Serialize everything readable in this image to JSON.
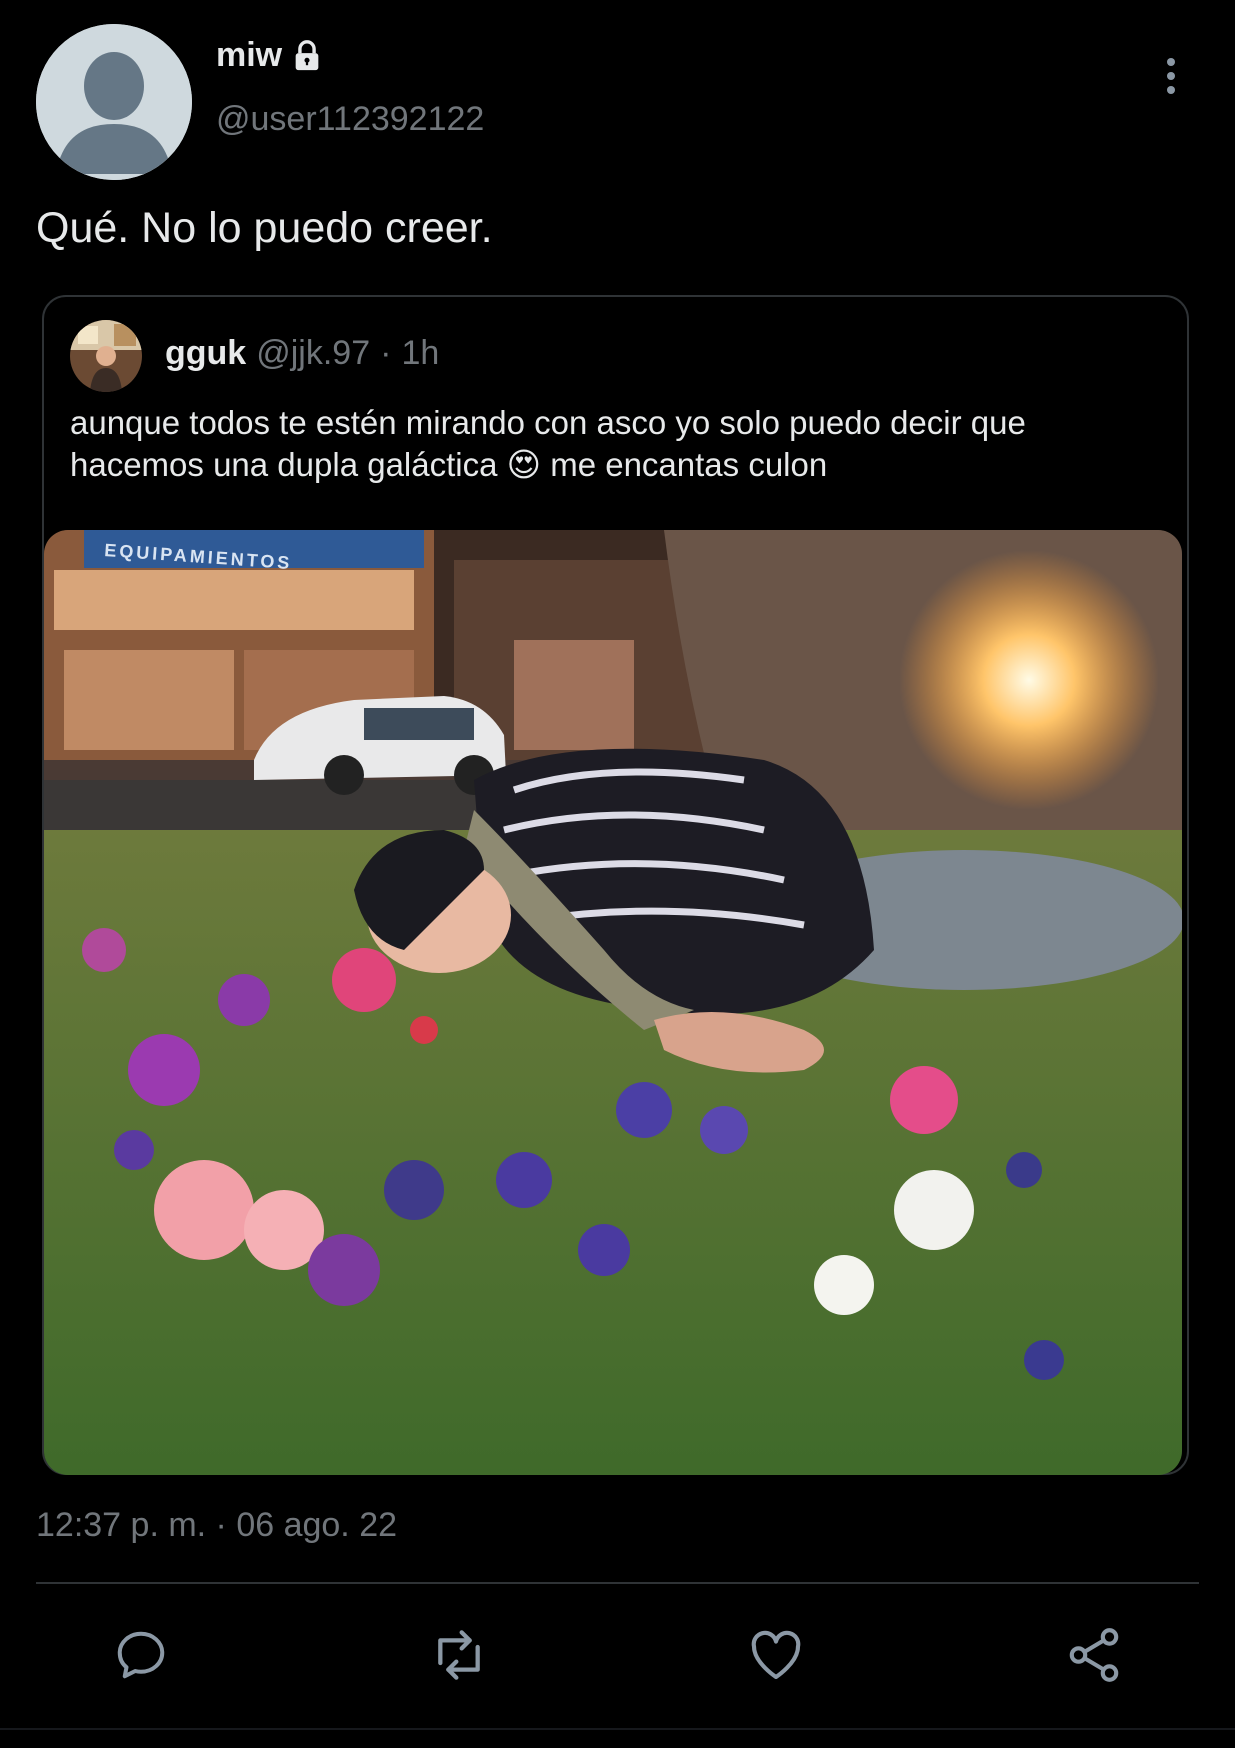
{
  "author": {
    "display_name": "miw",
    "handle": "@user112392122",
    "protected_icon": "lock-icon",
    "avatar_icon": "default-avatar-icon"
  },
  "tweet": {
    "text": "Qué. No lo puedo creer.",
    "timestamp": "12:37 p. m. · 06 ago. 22"
  },
  "quoted": {
    "display_name": "gguk",
    "handle": "@jjk.97",
    "separator": "·",
    "time": "1h",
    "text_line1": "aunque todos te estén mirando con asco yo solo puedo decir que",
    "text_line2_a": "hacemos una dupla galáctica",
    "emoji": "😍",
    "text_line2_b": "me encantas culon",
    "photo_sign_text": "EQUIPAMIENTOS"
  },
  "actions": [
    {
      "name": "reply",
      "icon": "reply-icon"
    },
    {
      "name": "retweet",
      "icon": "retweet-icon"
    },
    {
      "name": "like",
      "icon": "heart-icon"
    },
    {
      "name": "share",
      "icon": "share-icon"
    }
  ],
  "colors": {
    "background": "#000000",
    "text_primary": "#e7e9ea",
    "text_secondary": "#71767b",
    "border": "#2f3336"
  }
}
